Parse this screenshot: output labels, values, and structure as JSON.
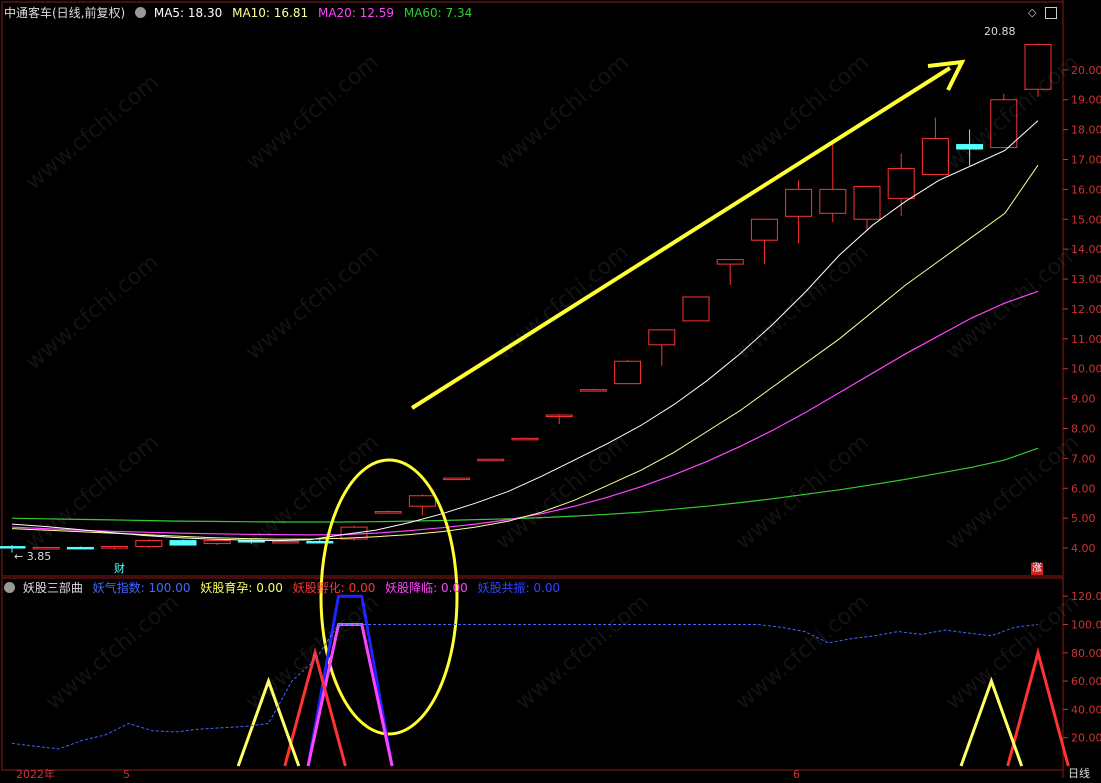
{
  "header": {
    "stock_label": "中通客车(日线,前复权)",
    "ma5_label": "MA5: 18.30",
    "ma10_label": "MA10: 16.81",
    "ma20_label": "MA20: 12.59",
    "ma60_label": "MA60: 7.34"
  },
  "sub_header": {
    "indicator_name": "妖股三部曲",
    "items": [
      {
        "label": "妖气指数: 100.00",
        "color": "#4466ff"
      },
      {
        "label": "妖股育孕: 0.00",
        "color": "#ffff66"
      },
      {
        "label": "妖股孵化: 0.00",
        "color": "#ff3333"
      },
      {
        "label": "妖股降临: 0.00",
        "color": "#ff44ff"
      },
      {
        "label": "妖股共振: 0.00",
        "color": "#3344ff"
      }
    ]
  },
  "annotations": {
    "high_label": "20.88",
    "low_label": "3.85",
    "cai_badge": "财",
    "zhang_badge": "涨",
    "date_left": "2022年",
    "date_mid1": "5",
    "date_mid2": "6",
    "period_label": "日线"
  },
  "icons": {
    "settings": "circle-chevron-icon",
    "window": "restore-window-icon",
    "diamond": "diamond-icon"
  },
  "colors": {
    "up": "#ff3333",
    "down": "#54ffff",
    "ma5": "#ffffff",
    "ma10": "#ffff99",
    "ma20": "#ff44ff",
    "ma60": "#33cc33",
    "highlight": "#ffff33"
  },
  "chart_data": [
    {
      "type": "candlestick",
      "yaxis_ticks": [
        4.0,
        5.0,
        6.0,
        7.0,
        8.0,
        9.0,
        10.0,
        11.0,
        12.0,
        13.0,
        14.0,
        15.0,
        16.0,
        17.0,
        18.0,
        19.0,
        20.0
      ],
      "ylim": [
        3.6,
        21.6
      ],
      "candles": [
        {
          "o": 4.05,
          "h": 4.1,
          "l": 3.85,
          "c": 4.0
        },
        {
          "o": 4.0,
          "h": 4.05,
          "l": 3.95,
          "c": 4.02
        },
        {
          "o": 4.02,
          "h": 4.05,
          "l": 3.95,
          "c": 3.98
        },
        {
          "o": 4.0,
          "h": 4.08,
          "l": 3.95,
          "c": 4.05
        },
        {
          "o": 4.05,
          "h": 4.3,
          "l": 4.0,
          "c": 4.25
        },
        {
          "o": 4.25,
          "h": 4.28,
          "l": 4.15,
          "c": 4.1
        },
        {
          "o": 4.15,
          "h": 4.3,
          "l": 4.1,
          "c": 4.25
        },
        {
          "o": 4.25,
          "h": 4.3,
          "l": 4.15,
          "c": 4.2
        },
        {
          "o": 4.2,
          "h": 4.25,
          "l": 4.15,
          "c": 4.22
        },
        {
          "o": 4.22,
          "h": 4.28,
          "l": 4.18,
          "c": 4.2
        },
        {
          "o": 4.3,
          "h": 4.75,
          "l": 4.25,
          "c": 4.7
        },
        {
          "o": 5.2,
          "h": 5.25,
          "l": 5.15,
          "c": 5.22
        },
        {
          "o": 5.4,
          "h": 5.8,
          "l": 5.1,
          "c": 5.75
        },
        {
          "o": 6.33,
          "h": 6.36,
          "l": 6.3,
          "c": 6.34
        },
        {
          "o": 6.96,
          "h": 6.99,
          "l": 6.94,
          "c": 6.97
        },
        {
          "o": 7.66,
          "h": 7.69,
          "l": 7.64,
          "c": 7.67
        },
        {
          "o": 8.4,
          "h": 8.48,
          "l": 8.15,
          "c": 8.45
        },
        {
          "o": 9.29,
          "h": 9.33,
          "l": 9.27,
          "c": 9.3
        },
        {
          "o": 9.5,
          "h": 10.3,
          "l": 9.5,
          "c": 10.25
        },
        {
          "o": 10.8,
          "h": 11.3,
          "l": 10.1,
          "c": 11.3
        },
        {
          "o": 11.6,
          "h": 12.4,
          "l": 11.6,
          "c": 12.4
        },
        {
          "o": 13.5,
          "h": 13.65,
          "l": 12.8,
          "c": 13.65
        },
        {
          "o": 14.3,
          "h": 15.0,
          "l": 13.5,
          "c": 15.0
        },
        {
          "o": 15.1,
          "h": 16.3,
          "l": 14.2,
          "c": 16.0
        },
        {
          "o": 15.2,
          "h": 17.5,
          "l": 14.9,
          "c": 16.0
        },
        {
          "o": 15.0,
          "h": 16.1,
          "l": 14.6,
          "c": 16.1
        },
        {
          "o": 15.7,
          "h": 17.2,
          "l": 15.1,
          "c": 16.7
        },
        {
          "o": 16.5,
          "h": 18.4,
          "l": 16.5,
          "c": 17.7
        },
        {
          "o": 17.5,
          "h": 18.0,
          "l": 16.8,
          "c": 17.35
        },
        {
          "o": 17.4,
          "h": 19.2,
          "l": 17.4,
          "c": 19.0
        },
        {
          "o": 19.35,
          "h": 20.88,
          "l": 19.1,
          "c": 20.85
        }
      ],
      "ma5": [
        4.8,
        4.72,
        4.62,
        4.52,
        4.42,
        4.35,
        4.3,
        4.27,
        4.25,
        4.28,
        4.45,
        4.6,
        4.85,
        5.15,
        5.5,
        5.9,
        6.4,
        6.95,
        7.5,
        8.1,
        8.8,
        9.6,
        10.5,
        11.5,
        12.6,
        13.8,
        14.8,
        15.6,
        16.3,
        16.8,
        17.3,
        18.3
      ],
      "ma10": [
        4.65,
        4.6,
        4.55,
        4.5,
        4.45,
        4.4,
        4.35,
        4.32,
        4.3,
        4.3,
        4.33,
        4.38,
        4.45,
        4.55,
        4.7,
        4.9,
        5.2,
        5.6,
        6.1,
        6.6,
        7.2,
        7.9,
        8.6,
        9.4,
        10.2,
        11.0,
        11.9,
        12.8,
        13.6,
        14.4,
        15.2,
        16.81
      ],
      "ma20": [
        4.7,
        4.65,
        4.6,
        4.56,
        4.53,
        4.5,
        4.48,
        4.46,
        4.45,
        4.44,
        4.45,
        4.5,
        4.58,
        4.68,
        4.8,
        4.95,
        5.15,
        5.4,
        5.7,
        6.05,
        6.45,
        6.9,
        7.4,
        7.95,
        8.55,
        9.2,
        9.85,
        10.5,
        11.1,
        11.7,
        12.2,
        12.59
      ],
      "ma60": [
        5.0,
        4.98,
        4.96,
        4.94,
        4.92,
        4.9,
        4.89,
        4.88,
        4.87,
        4.87,
        4.87,
        4.88,
        4.9,
        4.92,
        4.95,
        4.98,
        5.02,
        5.07,
        5.13,
        5.2,
        5.3,
        5.4,
        5.52,
        5.65,
        5.8,
        5.95,
        6.12,
        6.3,
        6.5,
        6.7,
        6.95,
        7.34
      ]
    },
    {
      "type": "line",
      "yaxis_ticks": [
        20.0,
        40.0,
        60.0,
        80.0,
        100.0,
        120.0
      ],
      "ylim": [
        0,
        130
      ],
      "series": [
        {
          "name": "妖气指数",
          "color": "#4466ff",
          "values": [
            16,
            14,
            12,
            18,
            22,
            30,
            25,
            24,
            26,
            27,
            28,
            30,
            60,
            75,
            100,
            100,
            100,
            100,
            100,
            100,
            100,
            100,
            100,
            100,
            100,
            100,
            100,
            100,
            100,
            100,
            100,
            100,
            100,
            98,
            95,
            87,
            90,
            92,
            95,
            93,
            96,
            94,
            92,
            98,
            100
          ]
        },
        {
          "name": "妖股共振",
          "color": "#2222ff",
          "values": [
            0,
            0,
            0,
            0,
            0,
            0,
            0,
            0,
            0,
            0,
            0,
            0,
            0,
            0,
            120,
            120,
            0,
            0,
            0,
            0,
            0,
            0,
            0,
            0,
            0,
            0,
            0,
            0,
            0,
            0,
            0,
            0,
            0,
            0,
            0,
            0,
            0,
            0,
            0,
            0,
            0,
            0,
            0,
            0,
            0
          ]
        },
        {
          "name": "妖股降临",
          "color": "#ff44ff",
          "values": [
            0,
            0,
            0,
            0,
            0,
            0,
            0,
            0,
            0,
            0,
            0,
            0,
            0,
            0,
            100,
            100,
            0,
            0,
            0,
            0,
            0,
            0,
            0,
            0,
            0,
            0,
            0,
            0,
            0,
            0,
            0,
            0,
            0,
            0,
            0,
            0,
            0,
            0,
            0,
            0,
            0,
            0,
            0,
            0,
            0
          ]
        },
        {
          "name": "妖股孵化",
          "color": "#ff3333",
          "values": [
            0,
            0,
            0,
            0,
            0,
            0,
            0,
            0,
            0,
            0,
            0,
            0,
            0,
            80,
            0,
            0,
            0,
            0,
            0,
            0,
            0,
            0,
            0,
            0,
            0,
            0,
            0,
            0,
            0,
            0,
            0,
            0,
            0,
            0,
            0,
            0,
            0,
            0,
            0,
            0,
            0,
            0,
            0,
            0,
            80
          ]
        },
        {
          "name": "妖股育孕",
          "color": "#ffff66",
          "values": [
            0,
            0,
            0,
            0,
            0,
            0,
            0,
            0,
            0,
            0,
            0,
            60,
            0,
            0,
            0,
            0,
            0,
            0,
            0,
            0,
            0,
            0,
            0,
            0,
            0,
            0,
            0,
            0,
            0,
            0,
            0,
            0,
            0,
            0,
            0,
            0,
            0,
            0,
            0,
            0,
            0,
            0,
            60,
            0,
            0
          ]
        }
      ]
    }
  ]
}
